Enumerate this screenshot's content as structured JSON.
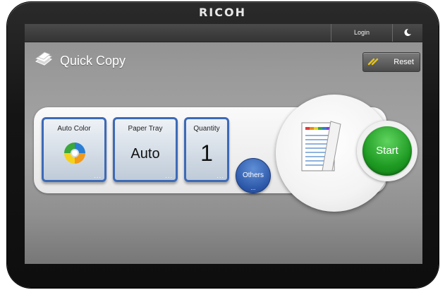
{
  "device": {
    "brand": "RICOH"
  },
  "topbar": {
    "login_label": "Login",
    "sleep_icon": "moon-icon"
  },
  "header": {
    "title": "Quick Copy",
    "title_icon": "copy-pages-icon",
    "reset_label": "Reset",
    "reset_icon": "reset-arrows-icon"
  },
  "settings": {
    "color_mode": {
      "label": "Auto Color",
      "icon": "auto-color-swirl-icon",
      "more": "..."
    },
    "paper_tray": {
      "label": "Paper Tray",
      "value": "Auto",
      "more": "..."
    },
    "quantity": {
      "label": "Quantity",
      "value": "1",
      "more": "..."
    },
    "others": {
      "label": "Others",
      "more": "..."
    }
  },
  "preview": {
    "icon": "document-preview-icon"
  },
  "start": {
    "label": "Start"
  },
  "colors": {
    "tile_border": "#3d6ab7",
    "start_green": "#1e9a22",
    "others_blue": "#2c57a8",
    "reset_accent": "#e6c21a"
  }
}
